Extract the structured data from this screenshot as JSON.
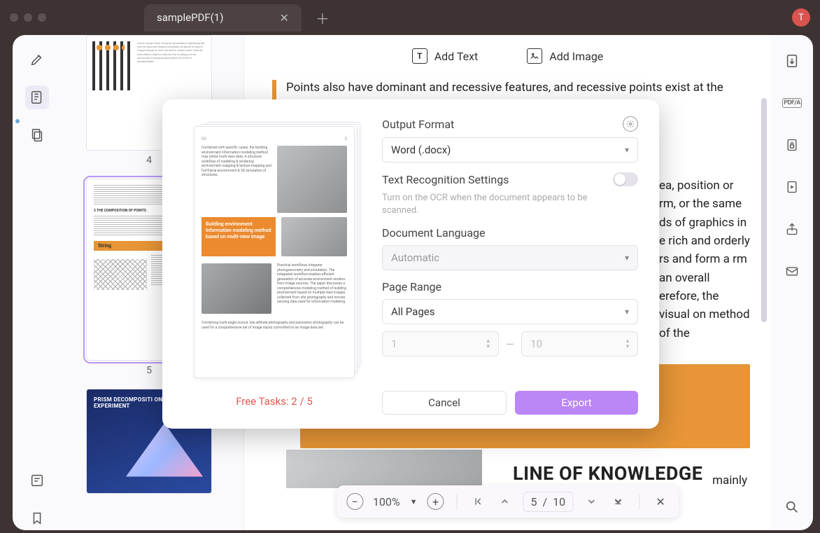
{
  "titlebar": {
    "tab_title": "samplePDF(1)",
    "avatar_letter": "T"
  },
  "doc_toolbar": {
    "add_text": "Add Text",
    "add_image": "Add Image"
  },
  "thumbs": {
    "p4": "4",
    "p5": "5",
    "p5_string": "String",
    "p6_title": "PRISM DECOMPOSITI ON SUNLIGHT EXPERIMENT"
  },
  "document": {
    "para1": "Points also have dominant and recessive features, and recessive points exist at the",
    "para2_frag": "ea, position or rm, or the same ds of graphics in e rich and orderly rs and form a rm an overall erefore, the visual on method of the",
    "heading": "LINE OF KNOWLEDGE",
    "tail": "mainly"
  },
  "page_controls": {
    "zoom": "100%",
    "current": "5",
    "sep": "/",
    "total": "10"
  },
  "modal": {
    "output_format_label": "Output Format",
    "output_format_value": "Word (.docx)",
    "ocr_label": "Text Recognition Settings",
    "ocr_hint": "Turn on the OCR when the document appears to be scanned.",
    "lang_label": "Document Language",
    "lang_value": "Automatic",
    "range_label": "Page Range",
    "range_value": "All Pages",
    "range_from": "1",
    "range_to": "10",
    "cancel": "Cancel",
    "export": "Export",
    "free_tasks": "Free Tasks: 2 / 5",
    "preview_caption": "Building environment Information modeling method based on multi-view image"
  },
  "rightrail": {
    "pdfa": "PDF/A"
  }
}
